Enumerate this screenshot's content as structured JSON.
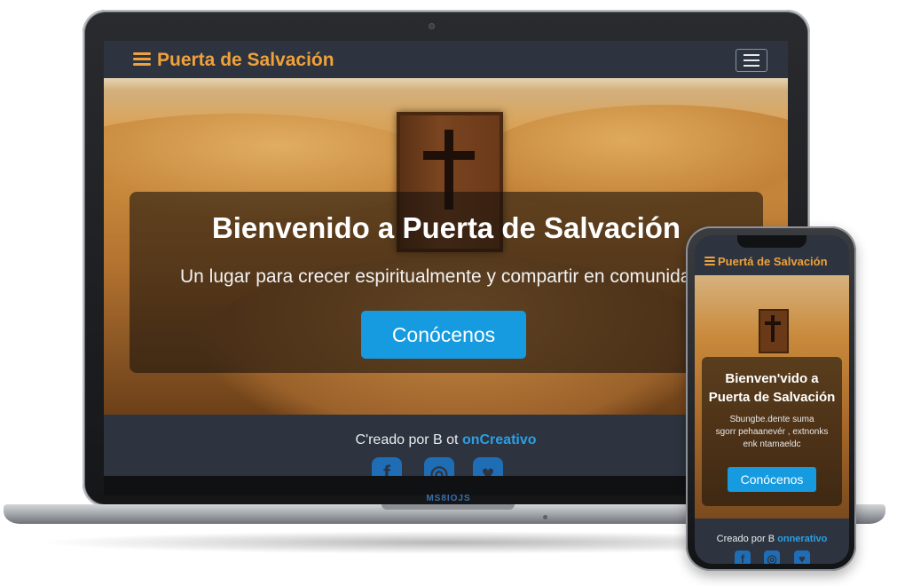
{
  "laptop": {
    "brand_label": "MS8IOJS",
    "navbar": {
      "site_title": "Puerta de Salvación"
    },
    "hero": {
      "title": "Bienvenido a Puerta de Salvación",
      "subtitle": "Un lugar para crecer espiritualmente y compartir en comunidad",
      "cta_label": "Conócenos"
    },
    "footer": {
      "credit_prefix": "C'reado por B ot ",
      "credit_brand": "onCreativo",
      "social_icons": [
        "facebook-icon",
        "instagram-icon",
        "heart-icon"
      ]
    }
  },
  "phone": {
    "navbar": {
      "site_title": "Puertá de Salvación"
    },
    "hero": {
      "title_line1": "Bienven'vido a",
      "title_line2": "Puerta de Salvación",
      "subtitle_line1": "Sbungbe.dente suma",
      "subtitle_line2": "sgorr pehaanevér , extnonks",
      "subtitle_line3": "enk ntamaeldc",
      "cta_label": "Conócenos"
    },
    "footer": {
      "credit_prefix": "Creado por B ",
      "credit_brand": "onnerativo"
    }
  },
  "colors": {
    "accent_orange": "#f0a13a",
    "cta_blue": "#169be0",
    "navbar_bg": "#2d343f",
    "brand_blue": "#2a9fe6"
  }
}
